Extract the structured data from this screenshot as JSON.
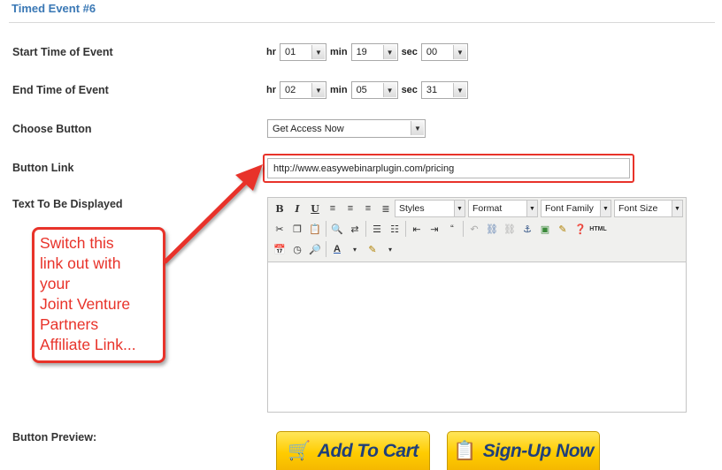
{
  "section": {
    "title": "Timed Event #6"
  },
  "start_time": {
    "label": "Start Time of Event",
    "hr_label": "hr",
    "min_label": "min",
    "sec_label": "sec",
    "hr": "01",
    "min": "19",
    "sec": "00"
  },
  "end_time": {
    "label": "End Time of Event",
    "hr_label": "hr",
    "min_label": "min",
    "sec_label": "sec",
    "hr": "02",
    "min": "05",
    "sec": "31"
  },
  "choose_button": {
    "label": "Choose Button",
    "value": "Get Access Now"
  },
  "button_link": {
    "label": "Button Link",
    "value": "http://www.easywebinarplugin.com/pricing"
  },
  "text_display": {
    "label": "Text To Be Displayed",
    "toolbar": {
      "bold": "B",
      "italic": "I",
      "underline": "U",
      "styles": "Styles",
      "format": "Format",
      "font_family": "Font Family",
      "font_size": "Font Size",
      "html": "HTML"
    }
  },
  "callout": {
    "lines": [
      "Switch this",
      "link out with",
      "your",
      "Joint Venture",
      "Partners",
      "Affiliate Link..."
    ]
  },
  "preview": {
    "label": "Button Preview:",
    "add_to_cart": "Add To Cart",
    "sign_up": "Sign-Up Now"
  },
  "colors": {
    "accent_red": "#e8332a",
    "title_blue": "#3a78b5",
    "button_yellow": "#ffcc00",
    "button_text": "#1f3f7a"
  }
}
